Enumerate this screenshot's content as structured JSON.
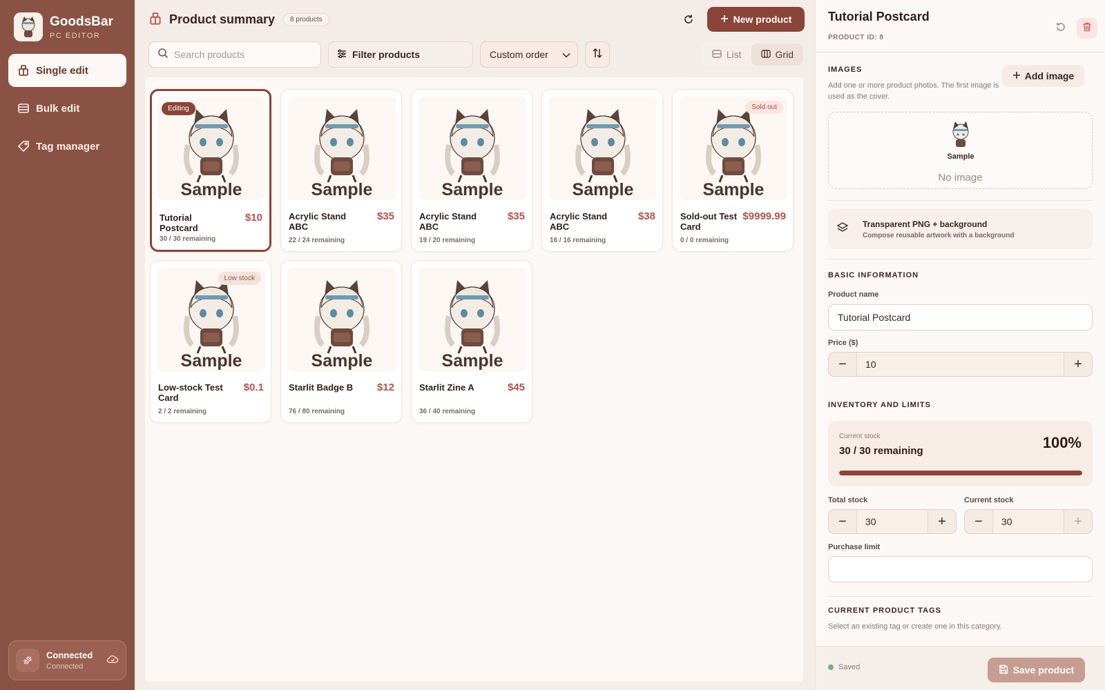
{
  "app": {
    "name": "GoodsBar",
    "subtitle": "PC EDITOR"
  },
  "sidebar": {
    "items": [
      {
        "label": "Single edit",
        "icon": "box-icon",
        "active": true
      },
      {
        "label": "Bulk edit",
        "icon": "layers-icon",
        "active": false
      },
      {
        "label": "Tag manager",
        "icon": "tag-icon",
        "active": false
      }
    ],
    "connection": {
      "title": "Connected",
      "status": "Connected"
    }
  },
  "header": {
    "title": "Product summary",
    "count": "8 products",
    "new_button": "New product"
  },
  "toolbar": {
    "search_placeholder": "Search products",
    "filter_label": "Filter products",
    "sort_label": "Custom order",
    "view_list": "List",
    "view_grid": "Grid"
  },
  "products": [
    {
      "name": "Tutorial Postcard",
      "price": "$10",
      "stock": "30 / 30 remaining",
      "badge": "Editing",
      "thumb_text": "Sample"
    },
    {
      "name": "Acrylic Stand ABC",
      "price": "$35",
      "stock": "22 / 24 remaining",
      "badge": "",
      "thumb_text": "Sample"
    },
    {
      "name": "Acrylic Stand ABC",
      "price": "$35",
      "stock": "19 / 20 remaining",
      "badge": "",
      "thumb_text": "Sample"
    },
    {
      "name": "Acrylic Stand ABC",
      "price": "$38",
      "stock": "16 / 16 remaining",
      "badge": "",
      "thumb_text": "Sample"
    },
    {
      "name": "Sold-out Test Card",
      "price": "$9999.99",
      "stock": "0 / 0 remaining",
      "badge": "Sold out",
      "thumb_text": "Sample"
    },
    {
      "name": "Low-stock Test Card",
      "price": "$0.1",
      "stock": "2 / 2 remaining",
      "badge": "Low stock",
      "thumb_text": "Sample"
    },
    {
      "name": "Starlit Badge B",
      "price": "$12",
      "stock": "76 / 80 remaining",
      "badge": "",
      "thumb_text": "Sample"
    },
    {
      "name": "Starlit Zine A",
      "price": "$45",
      "stock": "36 / 40 remaining",
      "badge": "",
      "thumb_text": "Sample"
    }
  ],
  "panel": {
    "title": "Tutorial Postcard",
    "product_id": "PRODUCT ID: 8",
    "images": {
      "label": "IMAGES",
      "help": "Add one or more product photos. The first image is used as the cover.",
      "add_button": "Add image",
      "thumb_text": "Sample",
      "empty": "No image"
    },
    "compose": {
      "title": "Transparent PNG + background",
      "subtitle": "Compose reusable artwork with a background"
    },
    "basic": {
      "label": "BASIC INFORMATION",
      "name_label": "Product name",
      "name_value": "Tutorial Postcard",
      "price_label": "Price ($)",
      "price_value": "10"
    },
    "inventory": {
      "label": "INVENTORY AND LIMITS",
      "current_label": "Current stock",
      "current_text": "30 / 30 remaining",
      "percent": "100%",
      "fill_fraction": 1.0,
      "total_label": "Total stock",
      "total_value": "30",
      "current_stock_label": "Current stock",
      "current_stock_value": "30",
      "limit_label": "Purchase limit",
      "limit_value": ""
    },
    "tags": {
      "label": "CURRENT PRODUCT TAGS",
      "help": "Select an existing tag or create one in this category."
    },
    "footer": {
      "saved": "Saved",
      "save_button": "Save product"
    }
  },
  "colors": {
    "sidebar": "#8a5244",
    "accent": "#8a4538",
    "price": "#b5534a",
    "saved_dot": "#6fb27d"
  }
}
